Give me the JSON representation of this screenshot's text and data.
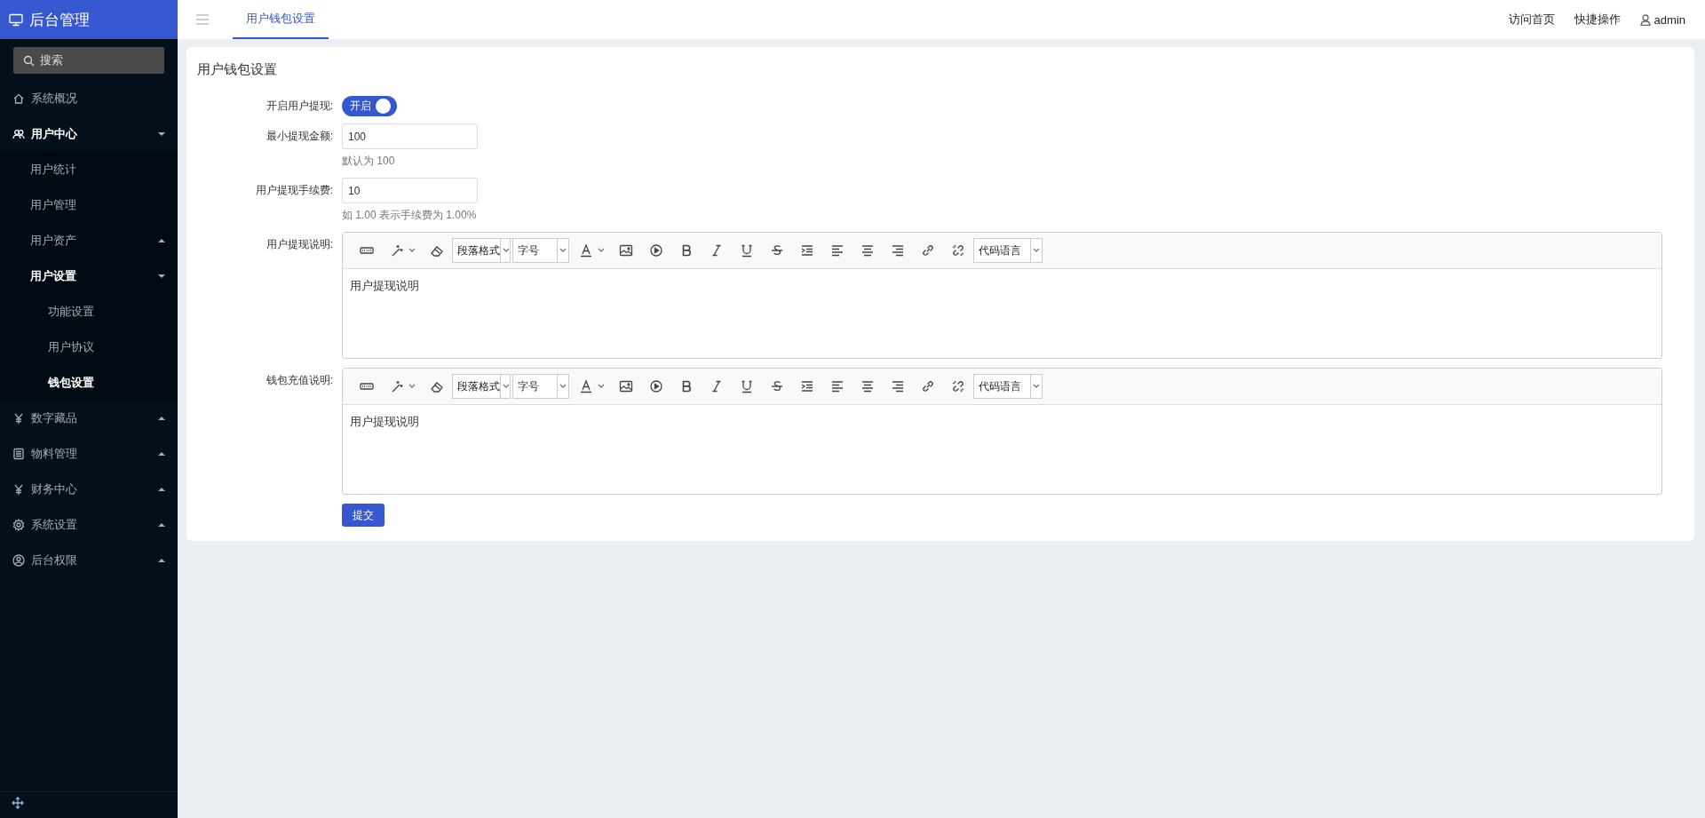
{
  "sidebar": {
    "title": "后台管理",
    "search": {
      "placeholder": "搜索"
    },
    "items": [
      {
        "label": "系统概况",
        "selected": false
      },
      {
        "label": "用户中心",
        "selected": true,
        "expanded": true,
        "children": [
          {
            "label": "用户统计",
            "selected": false
          },
          {
            "label": "用户管理",
            "selected": false
          },
          {
            "label": "用户资产",
            "selected": false,
            "expanded": false
          },
          {
            "label": "用户设置",
            "selected": true,
            "expanded": true,
            "children": [
              {
                "label": "功能设置",
                "selected": false
              },
              {
                "label": "用户协议",
                "selected": false
              },
              {
                "label": "钱包设置",
                "selected": true
              }
            ]
          }
        ]
      },
      {
        "label": "数字藏品",
        "selected": false,
        "expanded": false
      },
      {
        "label": "物料管理",
        "selected": false,
        "expanded": false
      },
      {
        "label": "财务中心",
        "selected": false,
        "expanded": false
      },
      {
        "label": "系统设置",
        "selected": false,
        "expanded": false
      },
      {
        "label": "后台权限",
        "selected": false,
        "expanded": false
      }
    ]
  },
  "top_bar": {
    "tabs": [
      {
        "label": "用户钱包设置",
        "selected": true
      }
    ],
    "links": [
      "访问首页",
      "快捷操作"
    ],
    "user": "admin"
  },
  "card": {
    "title": "用户钱包设置",
    "switch": {
      "label": "开启用户提现:",
      "on": true,
      "text": "开启"
    },
    "inputs": [
      {
        "label": "最小提现金额:",
        "value": "100",
        "hint": "默认为 100"
      },
      {
        "label": "用户提现手续费:",
        "value": "10",
        "hint": "如 1.00 表示手续费为 1.00%"
      }
    ],
    "editors": [
      {
        "label": "用户提现说明:",
        "content": "用户提现说明",
        "toolbar": {
          "format_select": "段落格式",
          "size_select": "字号",
          "code_select": "代码语言"
        }
      },
      {
        "label": "钱包充值说明:",
        "content": "用户提现说明",
        "toolbar": {
          "format_select": "段落格式",
          "size_select": "字号",
          "code_select": "代码语言"
        }
      }
    ],
    "submit": "提交"
  }
}
